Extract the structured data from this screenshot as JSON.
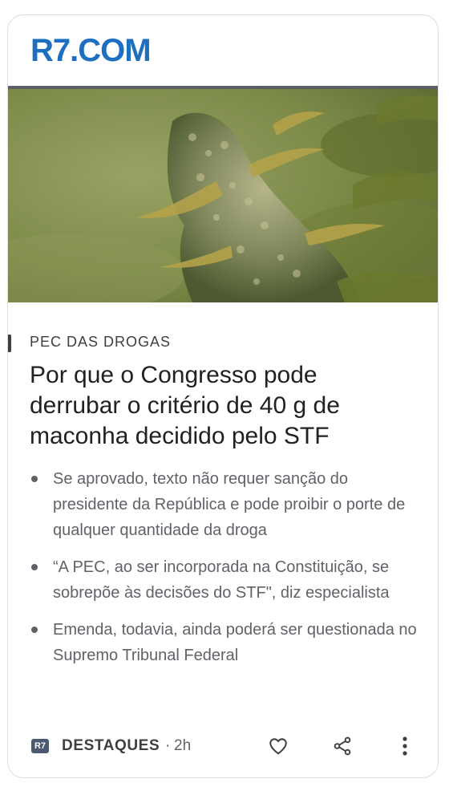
{
  "brand": {
    "logo_text": "R7.COM",
    "color": "#1d6fc0"
  },
  "hero": {
    "icon": "cannabis-plant-photo"
  },
  "article": {
    "category": "PEC DAS DROGAS",
    "headline": "Por que o Congresso pode derrubar o critério de 40 g de maconha decidido pelo STF",
    "bullets": [
      "Se aprovado, texto não requer sanção do presidente da República e pode proibir o porte de qualquer quantidade da droga",
      "“A PEC, ao ser incorporada na Constituição, se sobrepõe às decisões do STF\", diz especialista",
      "Emenda, todavia, ainda poderá ser questionada no Supremo Tribunal Federal"
    ]
  },
  "footer": {
    "source_icon_text": "R7",
    "source_name": "DESTAQUES",
    "separator": "·",
    "time": "2h",
    "actions": {
      "like_icon": "heart-icon",
      "share_icon": "share-icon",
      "more_icon": "more-vert-icon"
    }
  },
  "colors": {
    "text_primary": "#202124",
    "text_secondary": "#5f6368",
    "border": "#dadce0"
  }
}
